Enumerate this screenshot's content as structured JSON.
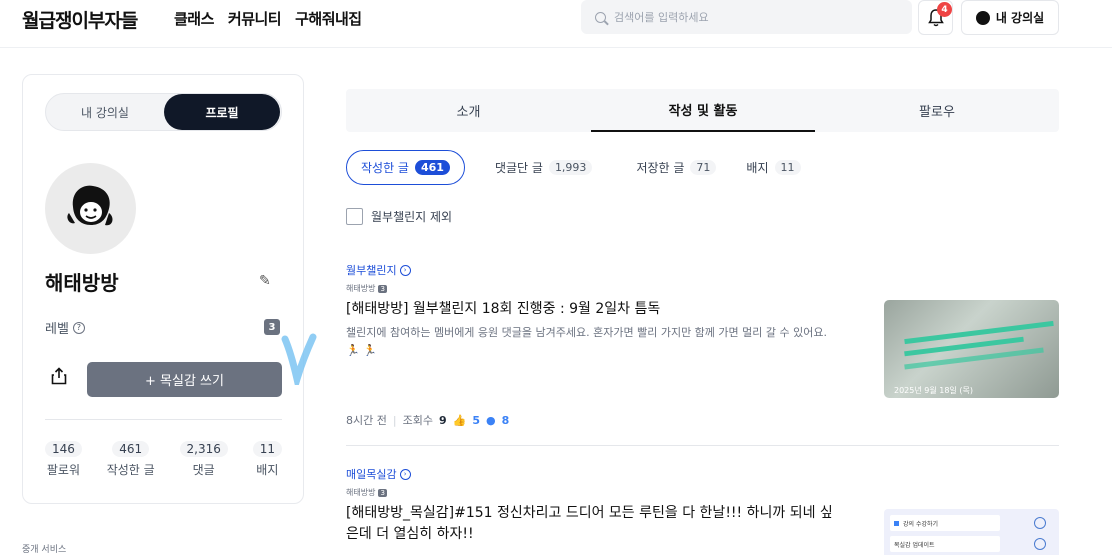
{
  "header": {
    "logo": "월급쟁이부자들",
    "nav": [
      "클래스",
      "커뮤니티",
      "구해줘내집"
    ],
    "search_placeholder": "검색어를 입력하세요",
    "notif_count": "4",
    "my_class_label": "내 강의실"
  },
  "profile": {
    "seg_my_class": "내 강의실",
    "seg_profile": "프로필",
    "username": "해태방방",
    "level_label": "레벨",
    "level_value": "3",
    "write_button": "+ 목실감 쓰기",
    "stats": [
      {
        "value": "146",
        "label": "팔로워"
      },
      {
        "value": "461",
        "label": "작성한 글"
      },
      {
        "value": "2,316",
        "label": "댓글"
      },
      {
        "value": "11",
        "label": "배지"
      }
    ],
    "footer": "중개 서비스"
  },
  "main": {
    "tabs": [
      "소개",
      "작성 및 활동",
      "팔로우"
    ],
    "active_tab": "작성 및 활동",
    "filters": [
      {
        "label": "작성한 글",
        "count": "461"
      },
      {
        "label": "댓글단 글",
        "count": "1,993"
      },
      {
        "label": "저장한 글",
        "count": "71"
      },
      {
        "label": "배지",
        "count": "11"
      }
    ],
    "exclude_checkbox": "월부챌린지 제외",
    "posts": [
      {
        "category": "월부챌린지",
        "author": "해태방방",
        "author_level": "3",
        "title": "[해태방방] 월부챌린지 18회 진행중 : 9월 2일차 틈독",
        "excerpt": "챌린지에 참여하는 멤버에게 응원 댓글을 남겨주세요. 혼자가면 빨리 가지만 함께 가면 멀리 갈 수 있어요. 🏃 🏃",
        "time": "8시간 전",
        "views_label": "조회수",
        "views": "9",
        "likes": "5",
        "comments": "8",
        "thumb_date": "2025년 9월 18일 (목)"
      },
      {
        "category": "매일목실감",
        "author": "해태방방",
        "author_level": "3",
        "title": "[해태방방_목실감]#151 정신차리고 드디어 모든 루틴을 다 한날!!! 하니까 되네 싶은데 더 열심히 하자!!",
        "thumb_rows": [
          "강의 수강하기",
          "목실감 업데이트"
        ]
      }
    ]
  }
}
